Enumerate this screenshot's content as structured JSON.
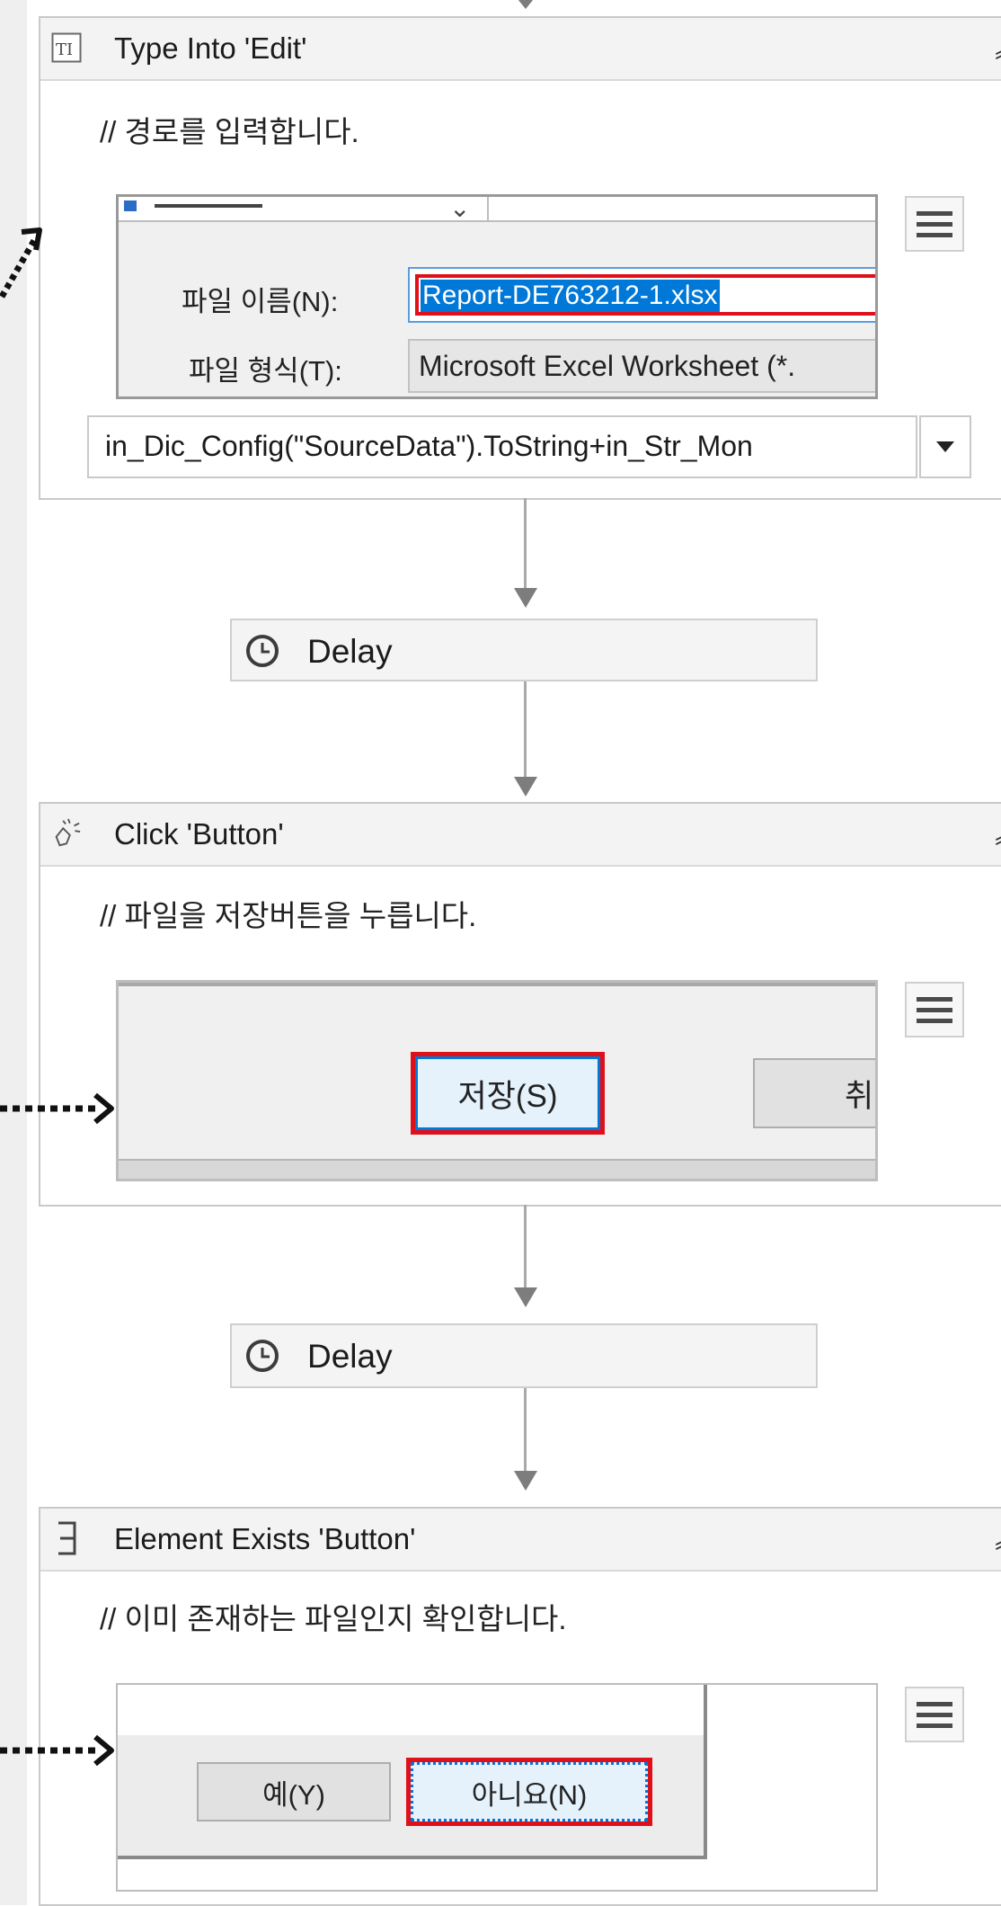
{
  "activities": [
    {
      "title": "Type Into 'Edit'",
      "annotation": "// 경로를 입력합니다.",
      "icon": "type-into-icon",
      "screenshot": {
        "filename_label": "파일 이름(N):",
        "filename_value": "Report-DE763212-1.xlsx",
        "filetype_label": "파일 형식(T):",
        "filetype_value": "Microsoft Excel Worksheet (*."
      },
      "text_expression": "in_Dic_Config(\"SourceData\").ToString+in_Str_Mon"
    },
    {
      "title": "Click 'Button'",
      "annotation": "// 파일을 저장버튼을 누릅니다.",
      "icon": "click-icon",
      "screenshot": {
        "save_button": "저장(S)",
        "cancel_button": "취소"
      }
    },
    {
      "title": "Element Exists 'Button'",
      "annotation": "// 이미 존재하는 파일인지 확인합니다.",
      "icon": "element-exists-icon",
      "screenshot": {
        "yes_button": "예(Y)",
        "no_button": "아니요(N)"
      }
    }
  ],
  "delays": [
    {
      "label": "Delay"
    },
    {
      "label": "Delay"
    }
  ],
  "colors": {
    "highlight": "#e0101a",
    "selection": "#0078d7",
    "header_bg": "#f3f3f3"
  }
}
